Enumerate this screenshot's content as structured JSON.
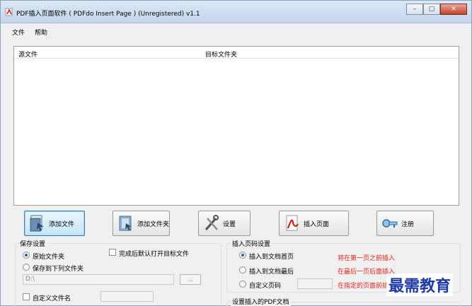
{
  "window": {
    "title": "PDF插入页面软件 ( PDFdo Insert Page )  (Unregistered) v1.1",
    "controls": {
      "minimize": "–",
      "maximize": "□",
      "close": "✕"
    }
  },
  "menu": {
    "file": "文件",
    "help": "帮助"
  },
  "file_list": {
    "columns": [
      "源文件",
      "目标文件夹"
    ]
  },
  "toolbar": {
    "add_file": "添加文件",
    "add_folder": "添加文件夹",
    "settings": "设置",
    "insert_page": "插入页面",
    "register": "注册"
  },
  "save_settings": {
    "title": "保存设置",
    "original_folder": "原始文件夹",
    "save_to_folder": "保存到下列文件夹",
    "open_after_done": "完成后默认打开目标文件",
    "folder_path": "D:\\",
    "browse": "...",
    "custom_filename": "自定义文件名",
    "next_label": "设置插入的PDF文档"
  },
  "insert_settings": {
    "title": "插入页码设置",
    "insert_first": "插入到文档首页",
    "insert_last": "插入到文档最后",
    "custom_page": "自定义页码",
    "hint_first": "将在第一页之前插入",
    "hint_last": "在最后一页后面插入",
    "hint_custom": "在指定的页面前插入"
  },
  "pdf_group": {
    "title": "设置插入的PDF文档"
  },
  "watermark": "最需教育",
  "colors": {
    "hint_red": "#e0251b",
    "watermark_blue": "#1f3aa6",
    "accent_blue": "#3c7fb1"
  }
}
